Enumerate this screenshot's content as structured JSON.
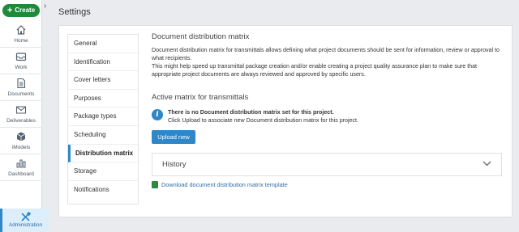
{
  "leftnav": {
    "create_label": "Create",
    "items": [
      {
        "label": "Home",
        "icon": "home-icon"
      },
      {
        "label": "Work",
        "icon": "inbox-icon"
      },
      {
        "label": "Documents",
        "icon": "document-icon"
      },
      {
        "label": "Deliverables",
        "icon": "send-icon"
      },
      {
        "label": "iModels",
        "icon": "imodel-icon"
      },
      {
        "label": "Dashboard",
        "icon": "dashboard-icon"
      }
    ],
    "admin_label": "Administration"
  },
  "header": {
    "title": "Settings"
  },
  "settings_menu": {
    "items": [
      {
        "label": "General"
      },
      {
        "label": "Identification"
      },
      {
        "label": "Cover letters"
      },
      {
        "label": "Purposes"
      },
      {
        "label": "Package types"
      },
      {
        "label": "Scheduling"
      },
      {
        "label": "Distribution matrix"
      },
      {
        "label": "Storage"
      },
      {
        "label": "Notifications"
      }
    ],
    "active": "Distribution matrix"
  },
  "content": {
    "title": "Document distribution matrix",
    "description_1": "Document distribution matrix for transmittals allows defining what project documents should be sent for information, review or approval to what recipients.",
    "description_2": "This might help speed up transmittal package creation and/or enable creating a project quality assurance plan to make sure that appropriate project documents are always reviewed and approved by specific users.",
    "active_matrix_title": "Active matrix for transmittals",
    "notice_bold": "There is no Document distribution matrix set for this project.",
    "notice_text": "Click Upload to associate new Document distribution matrix for this project.",
    "upload_label": "Upload new",
    "history_label": "History",
    "download_label": "Download document distribution matrix template"
  },
  "colors": {
    "accent": "#2f87c8",
    "create": "#1f8a3a",
    "background": "#e9ebee"
  }
}
